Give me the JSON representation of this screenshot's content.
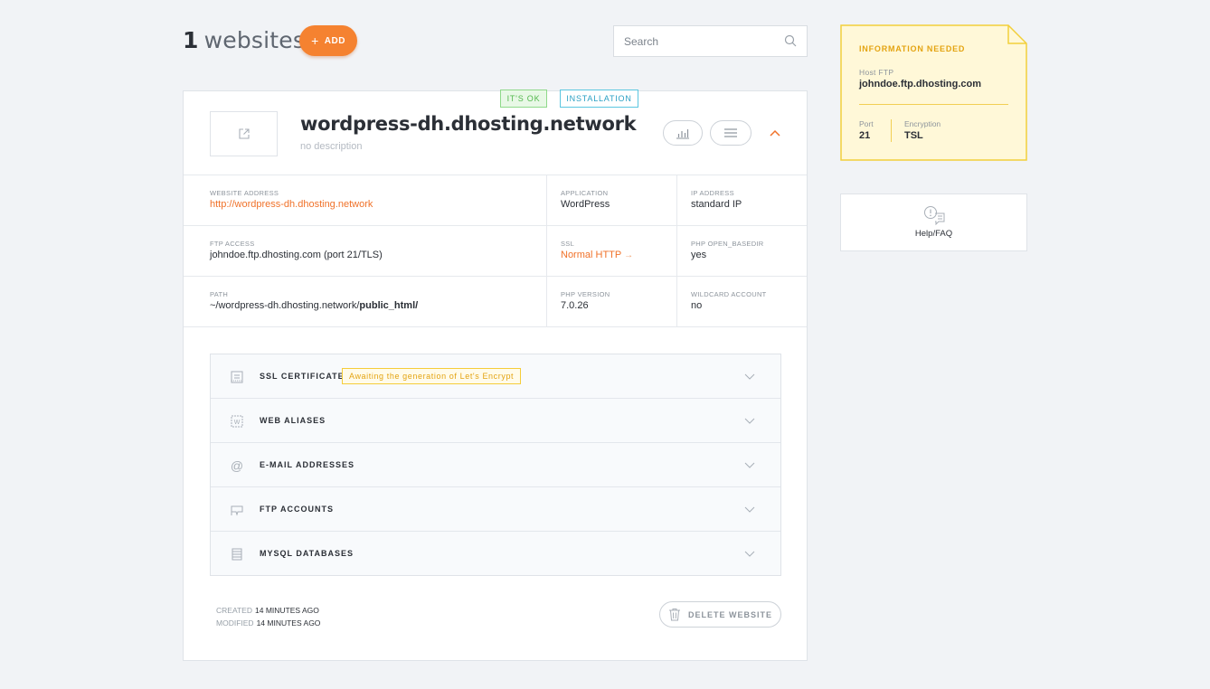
{
  "header": {
    "count": "1",
    "title": "websites",
    "add_label": "ADD",
    "search_placeholder": "Search"
  },
  "website": {
    "badges": {
      "ok": "IT'S OK",
      "installation": "INSTALLATION"
    },
    "name": "wordpress-dh.dhosting.network",
    "description": "no description",
    "info": [
      [
        {
          "label": "WEBSITE ADDRESS",
          "value": "http://wordpress-dh.dhosting.network"
        },
        {
          "label": "APPLICATION",
          "value": "WordPress"
        },
        {
          "label": "IP ADDRESS",
          "value": "standard IP"
        }
      ],
      [
        {
          "label": "FTP ACCESS",
          "value": "johndoe.ftp.dhosting.com (port 21/TLS)"
        },
        {
          "label": "SSL",
          "value": "Normal HTTP"
        },
        {
          "label": "PHP OPEN_BASEDIR",
          "value": "yes"
        }
      ],
      [
        {
          "label": "PATH",
          "value_prefix": "~/wordpress-dh.dhosting.network/",
          "value_bold": "public_html/"
        },
        {
          "label": "PHP VERSION",
          "value": "7.0.26"
        },
        {
          "label": "WILDCARD ACCOUNT",
          "value": "no"
        }
      ]
    ],
    "sections": [
      {
        "label": "SSL CERTIFICATE",
        "icon": "certificate-icon",
        "badge": "Awaiting the generation of Let's Encrypt"
      },
      {
        "label": "WEB ALIASES",
        "icon": "alias-icon"
      },
      {
        "label": "E-MAIL ADDRESSES",
        "icon": "at-icon"
      },
      {
        "label": "FTP ACCOUNTS",
        "icon": "ftp-icon"
      },
      {
        "label": "MYSQL DATABASES",
        "icon": "database-icon"
      }
    ],
    "created_label": "CREATED",
    "created_value": "14 MINUTES AGO",
    "modified_label": "MODIFIED",
    "modified_value": "14 MINUTES AGO",
    "delete_label": "DELETE WEBSITE"
  },
  "info_note": {
    "title": "INFORMATION NEEDED",
    "host_label": "Host FTP",
    "host_value": "johndoe.ftp.dhosting.com",
    "port_label": "Port",
    "port_value": "21",
    "encryption_label": "Encryption",
    "encryption_value": "TSL"
  },
  "help": {
    "label": "Help/FAQ"
  },
  "colors": {
    "accent": "#f58230",
    "link": "#f0722a",
    "note_bg": "#fff8d8",
    "note_border": "#f2cf3a",
    "ok_green": "#52b84c",
    "install_blue": "#2aa0c4"
  }
}
